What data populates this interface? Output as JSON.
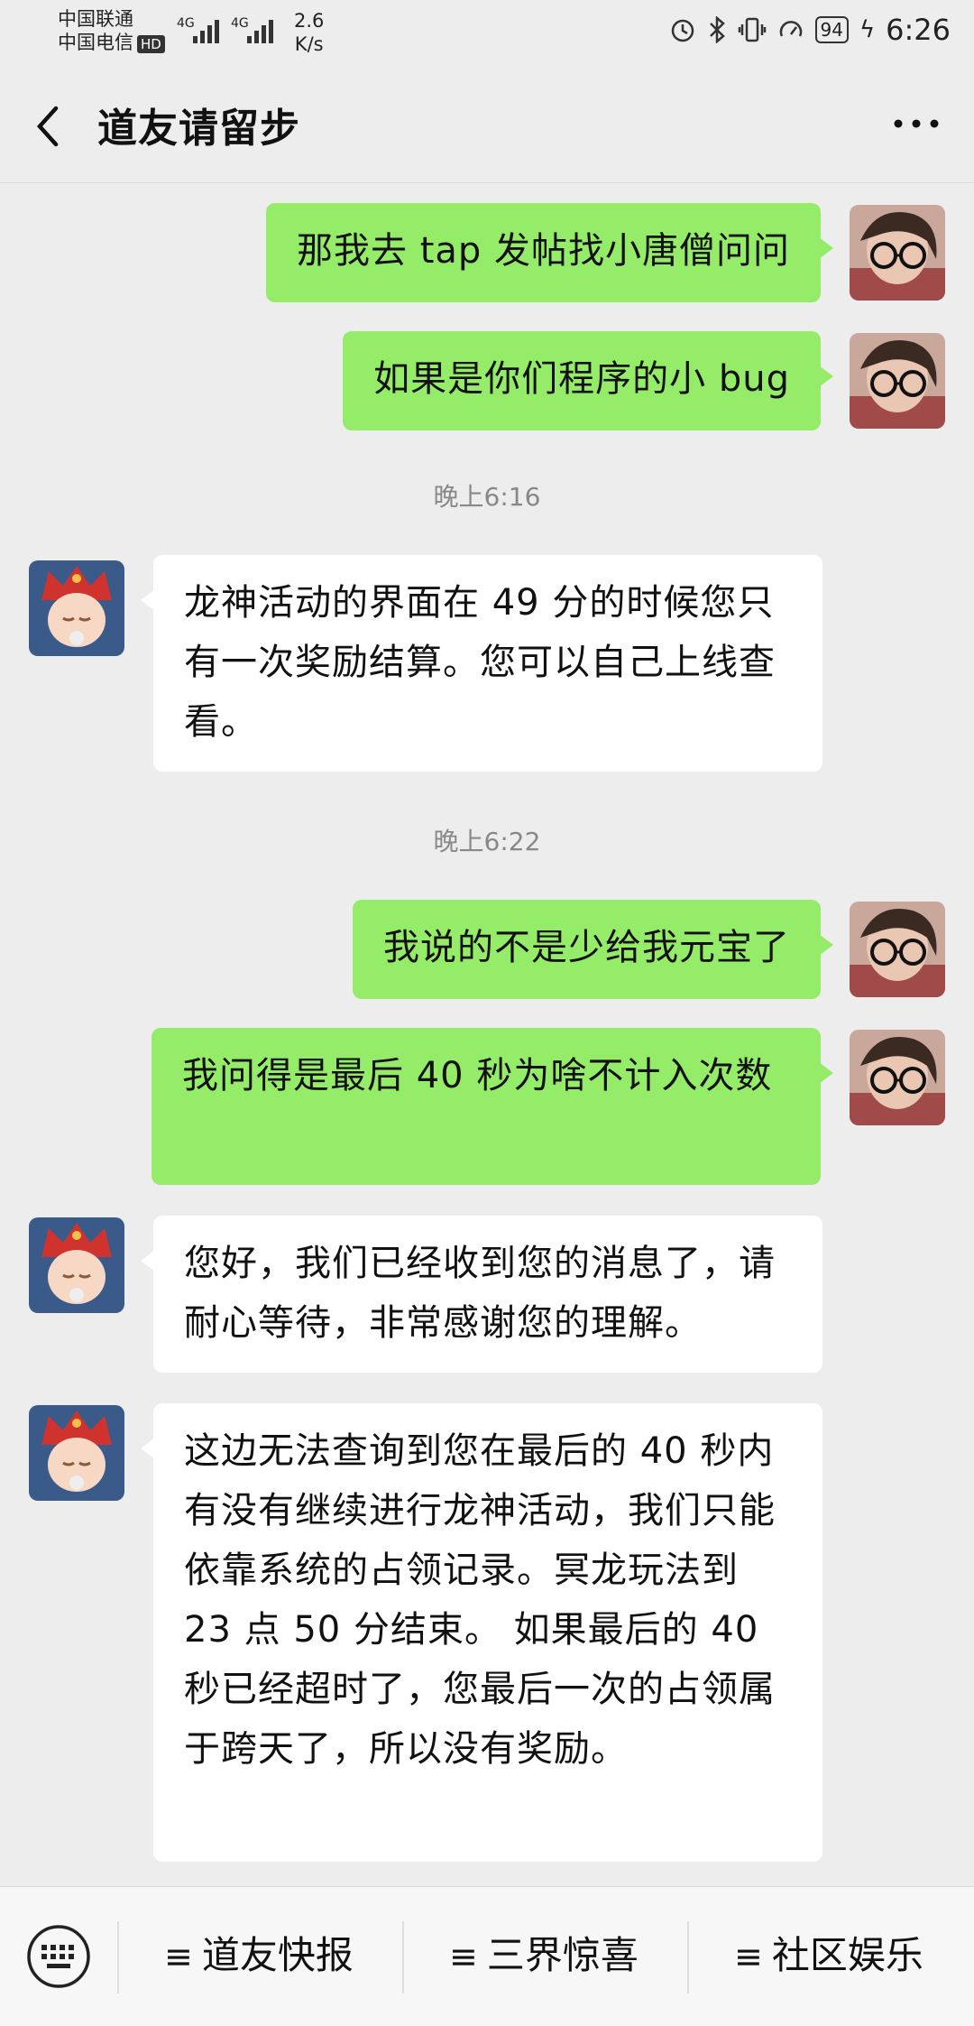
{
  "status_bar": {
    "carrier1": "中国联通",
    "carrier2": "中国电信",
    "hd": "HD",
    "net1": "4G",
    "net2": "4G",
    "speed_value": "2.6",
    "speed_unit": "K/s",
    "battery": "94",
    "time": "6:26"
  },
  "nav": {
    "title": "道友请留步",
    "back_icon": "chevron-left-icon",
    "more_icon": "more-dots-icon"
  },
  "messages": [
    {
      "side": "me",
      "text": "那我去 tap 发帖找小唐僧问问"
    },
    {
      "side": "me",
      "text": "如果是你们程序的小 bug"
    },
    {
      "timestamp": "晚上6:16"
    },
    {
      "side": "them",
      "text": "龙神活动的界面在 49 分的时候您只有一次奖励结算。您可以自己上线查看。"
    },
    {
      "timestamp": "晚上6:22"
    },
    {
      "side": "me",
      "text": "我说的不是少给我元宝了"
    },
    {
      "side": "me",
      "text": "我问得是最后 40 秒为啥不计入次数"
    },
    {
      "side": "them",
      "text": "您好，我们已经收到您的消息了，请耐心等待，非常感谢您的理解。"
    },
    {
      "side": "them",
      "text": "这边无法查询到您在最后的 40 秒内有没有继续进行龙神活动，我们只能依靠系统的占领记录。冥龙玩法到 23 点 50 分结束。 如果最后的 40 秒已经超时了，您最后一次的占领属于跨天了，所以没有奖励。"
    }
  ],
  "bottom_menu": {
    "keyboard_icon": "keyboard-icon",
    "items": [
      {
        "label": "道友快报"
      },
      {
        "label": "三界惊喜"
      },
      {
        "label": "社区娱乐"
      }
    ],
    "item_icon": "menu-lines-icon",
    "item_icon_glyph": "≡"
  }
}
